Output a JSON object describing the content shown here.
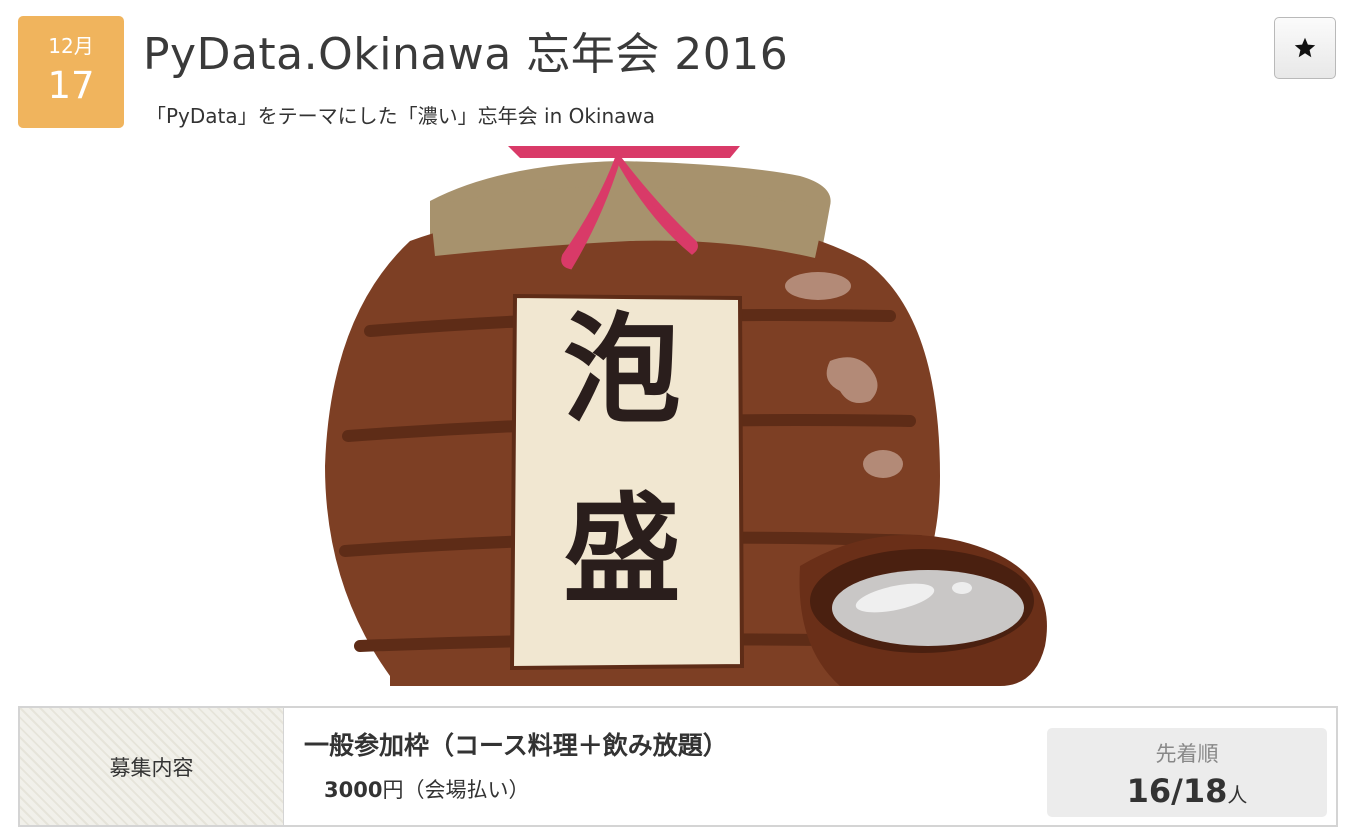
{
  "event": {
    "date": {
      "month": "12月",
      "day": "17"
    },
    "title": "PyData.Okinawa 忘年会 2016",
    "subtitle": "「PyData」をテーマにした「濃い」忘年会 in Okinawa",
    "bookmark_icon": "star-icon"
  },
  "hero": {
    "label_chars": [
      "泡",
      "盛"
    ],
    "illustration": "awamori-jar-and-cup"
  },
  "recruitment": {
    "label": "募集内容",
    "ticket": {
      "name": "一般参加枠（コース料理＋飲み放題）",
      "price": "3000",
      "price_suffix": "円（会場払い）"
    },
    "quota": {
      "type": "先着順",
      "current": "16",
      "separator": "/",
      "capacity": "18",
      "unit": "人"
    }
  },
  "colors": {
    "date_badge": "#f0b45d",
    "jar": "#7d3f24",
    "cloth": "#a7926d",
    "string": "#d93a68",
    "label": "#f1e7d1"
  }
}
